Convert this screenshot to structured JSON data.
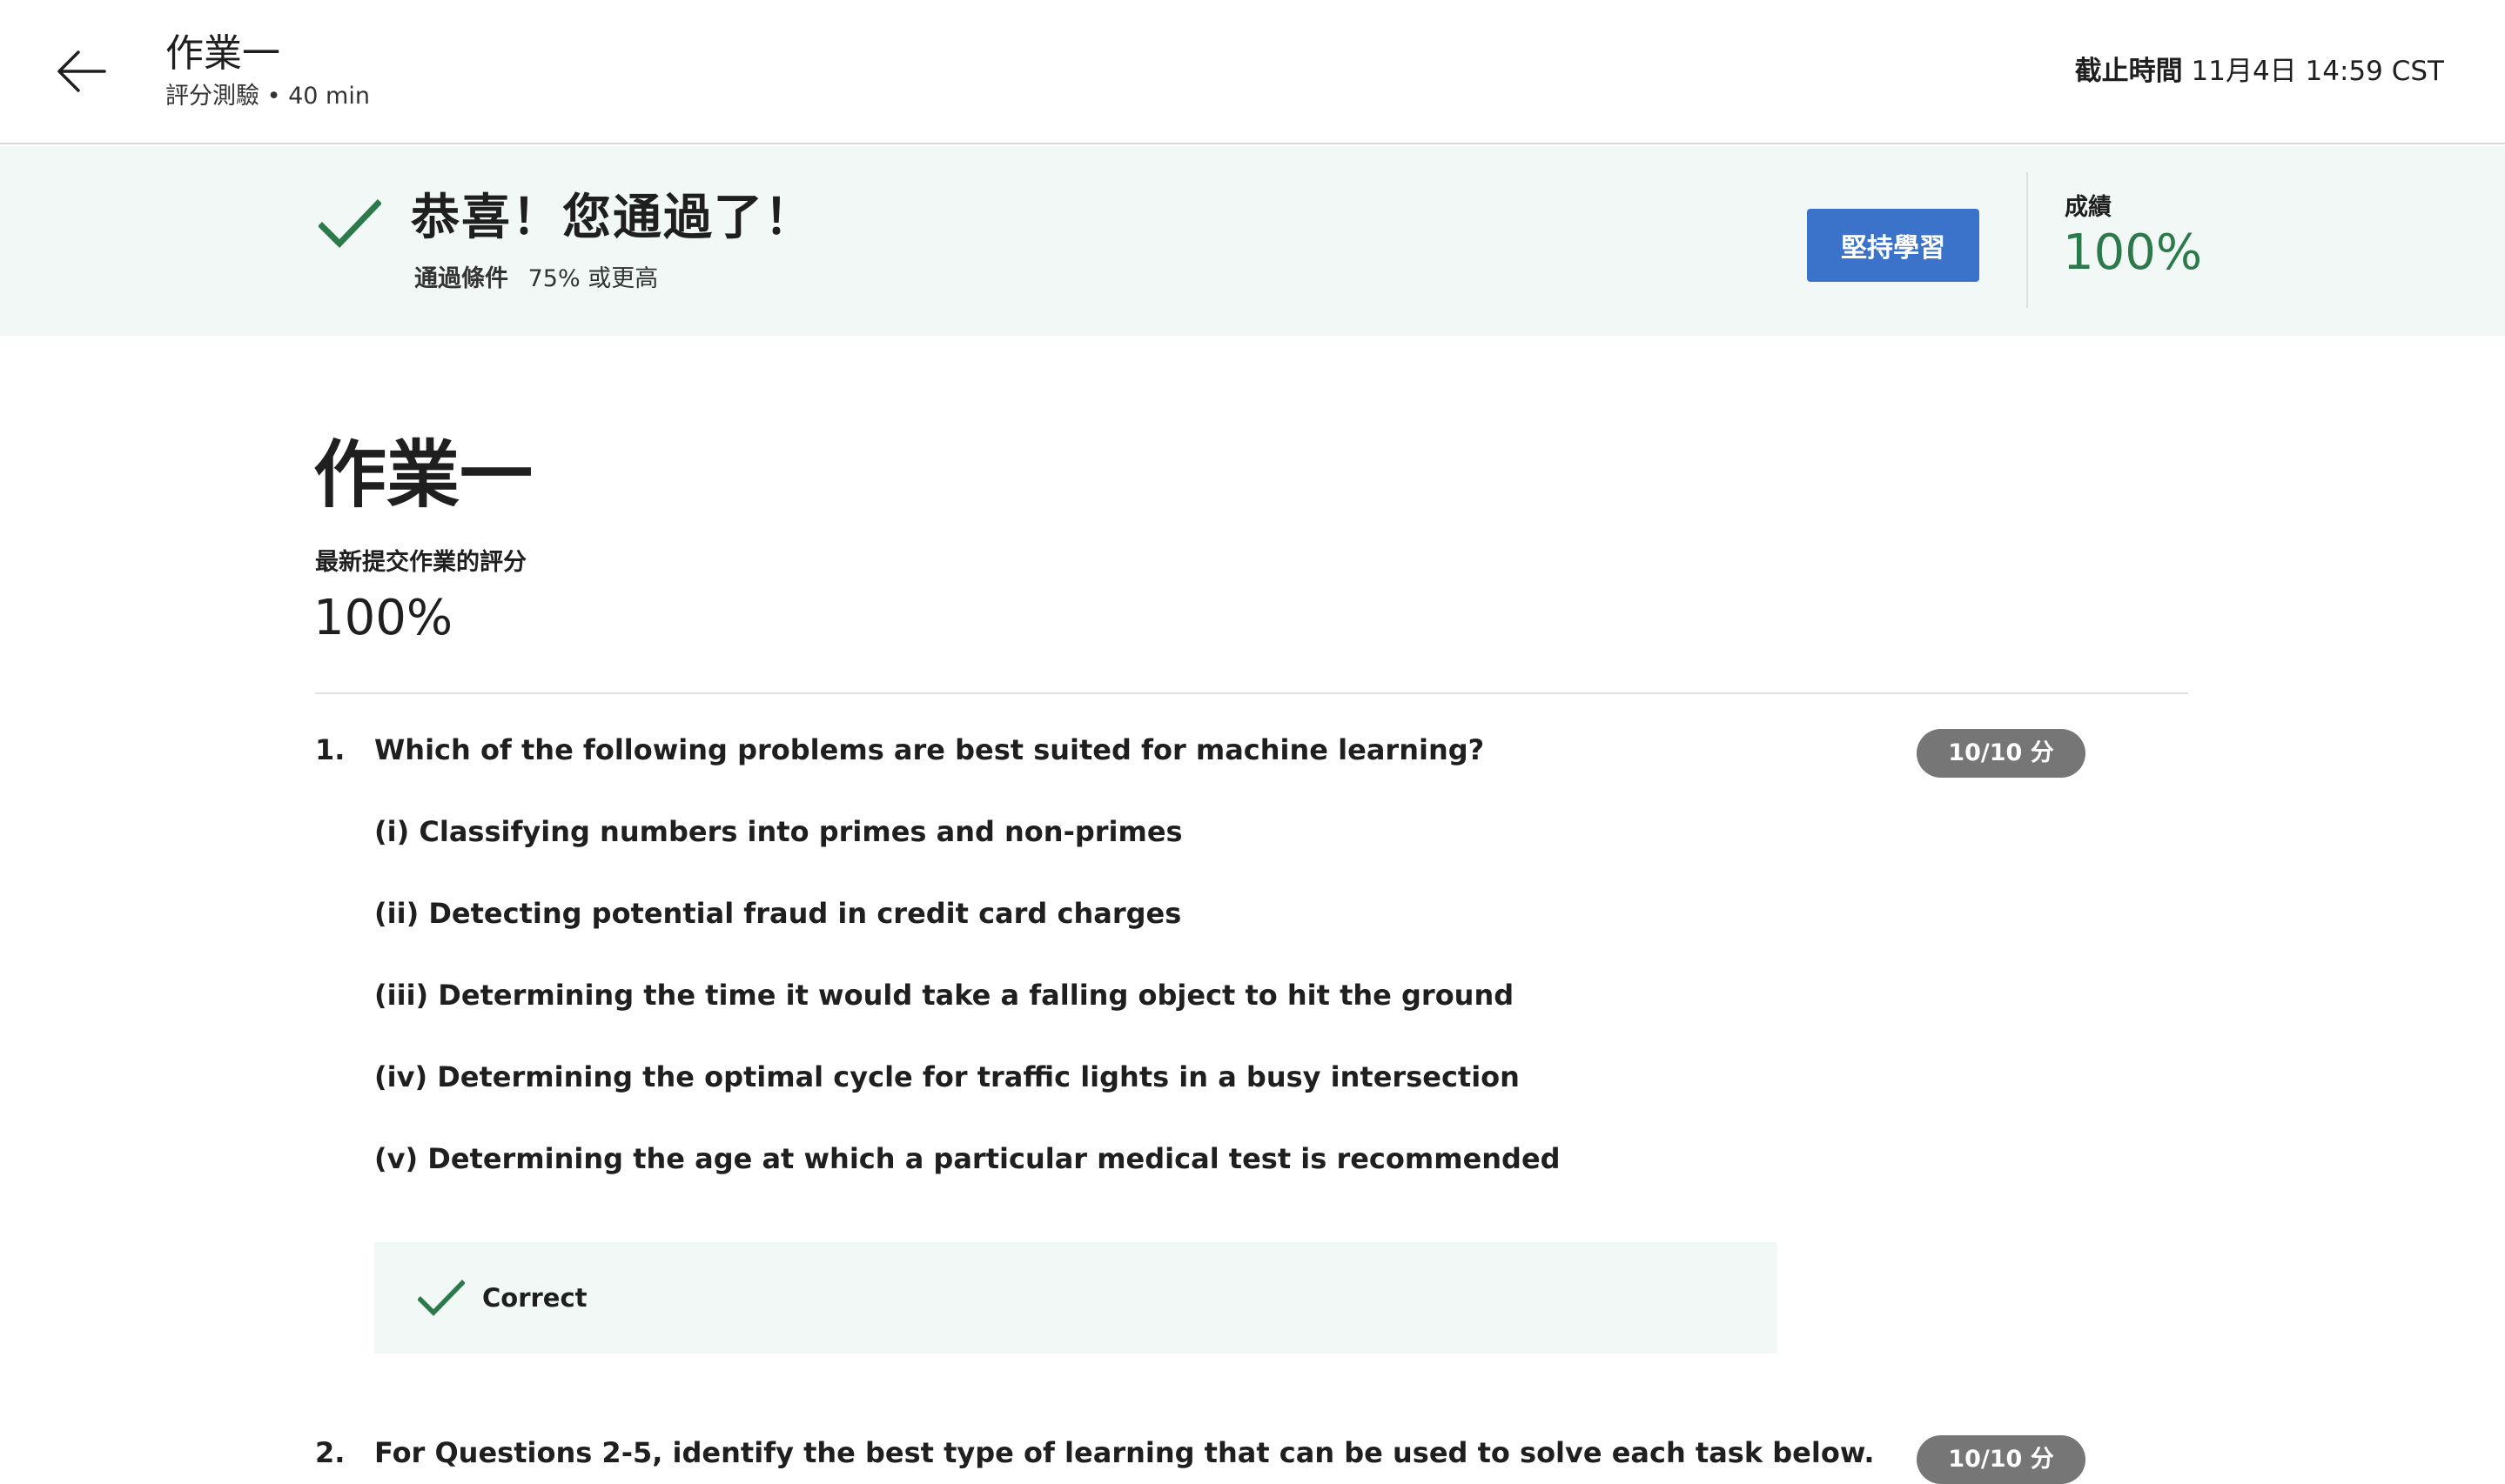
{
  "header": {
    "back_icon": "arrow-left-icon",
    "title": "作業一",
    "subtitle": "評分測驗 • 40 min",
    "deadline_label": "截止時間",
    "deadline_value": "11月4日 14:59 CST"
  },
  "banner": {
    "check_icon": "check-icon",
    "congrats": "恭喜！您通過了！",
    "pass_label": "通過條件",
    "pass_value": "75% 或更高",
    "keep_button": "堅持學習",
    "grade_label": "成績",
    "grade_value": "100%",
    "accent": "#2c7a4b",
    "button_color": "#3a73c9"
  },
  "main": {
    "title": "作業一",
    "latest_label": "最新提交作業的評分",
    "latest_value": "100%",
    "questions": [
      {
        "number": "1.",
        "text": "Which of the following problems are best suited for machine learning?",
        "score": "10/10 分",
        "options": [
          "(i) Classifying numbers into primes and non-primes",
          "(ii) Detecting potential fraud in credit card charges",
          "(iii) Determining the time it would take a falling object to hit the ground",
          "(iv) Determining the optimal cycle for traffic lights in a busy intersection",
          "(v) Determining the age at which a particular medical test is recommended"
        ],
        "feedback": "Correct"
      },
      {
        "number": "2.",
        "text": "For Questions 2-5, identify the best type of learning that can be used to solve each task below.",
        "score": "10/10 分"
      }
    ]
  }
}
